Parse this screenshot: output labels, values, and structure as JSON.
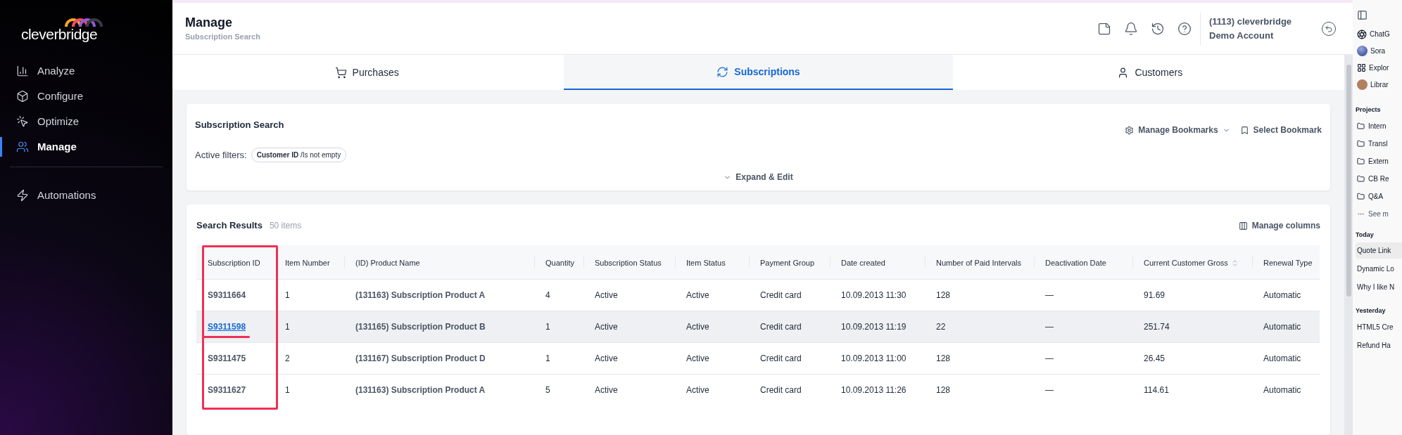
{
  "sidebar": {
    "logo": "cleverbridge",
    "items": [
      {
        "label": "Analyze",
        "selected": false
      },
      {
        "label": "Configure",
        "selected": false
      },
      {
        "label": "Optimize",
        "selected": false
      },
      {
        "label": "Manage",
        "selected": true
      }
    ],
    "bottom_items": [
      {
        "label": "Automations",
        "selected": false
      }
    ]
  },
  "header": {
    "title": "Manage",
    "subtitle": "Subscription Search",
    "account": "(1113) cleverbridge Demo Account"
  },
  "tabs": [
    {
      "label": "Purchases",
      "selected": false
    },
    {
      "label": "Subscriptions",
      "selected": true
    },
    {
      "label": "Customers",
      "selected": false
    }
  ],
  "search_card": {
    "title": "Subscription Search",
    "manage_bookmarks": "Manage Bookmarks",
    "select_bookmark": "Select Bookmark",
    "filters_label": "Active filters:",
    "filters": [
      "**Customer ID** /Is not empty"
    ],
    "expand": "Expand & Edit"
  },
  "results": {
    "title": "Search Results",
    "count": "50 items",
    "manage_columns": "Manage columns",
    "columns": [
      {
        "label": "Subscription ID",
        "sortable": false,
        "highlighted": true
      },
      {
        "label": "Item Number",
        "sortable": false,
        "highlighted": false
      },
      {
        "label": "(ID) Product Name",
        "sortable": false,
        "highlighted": false
      },
      {
        "label": "Quantity",
        "sortable": false,
        "highlighted": false
      },
      {
        "label": "Subscription Status",
        "sortable": false,
        "highlighted": false
      },
      {
        "label": "Item Status",
        "sortable": false,
        "highlighted": false
      },
      {
        "label": "Payment Group",
        "sortable": false,
        "highlighted": false
      },
      {
        "label": "Date created",
        "sortable": false,
        "highlighted": false
      },
      {
        "label": "Number of Paid Intervals",
        "sortable": false,
        "highlighted": false
      },
      {
        "label": "Deactivation Date",
        "sortable": false,
        "highlighted": false
      },
      {
        "label": "Current Customer Gross",
        "sortable": true,
        "highlighted": false
      },
      {
        "label": "Renewal Type",
        "sortable": false,
        "highlighted": false
      }
    ],
    "rows": [
      {
        "hovered": false,
        "id_link": false,
        "underlined": false,
        "cells": [
          "S9311664",
          "1",
          "(131163) Subscription Product A",
          "4",
          "Active",
          "Active",
          "Credit card",
          "10.09.2013 11:30",
          "128",
          "—",
          "91.69",
          "Automatic"
        ]
      },
      {
        "hovered": true,
        "id_link": true,
        "underlined": true,
        "cells": [
          "S9311598",
          "1",
          "(131165) Subscription Product B",
          "1",
          "Active",
          "Active",
          "Credit card",
          "10.09.2013 11:19",
          "22",
          "—",
          "251.74",
          "Automatic"
        ]
      },
      {
        "hovered": false,
        "id_link": false,
        "underlined": false,
        "cells": [
          "S9311475",
          "2",
          "(131167) Subscription Product D",
          "1",
          "Active",
          "Active",
          "Credit card",
          "10.09.2013 11:00",
          "128",
          "—",
          "26.45",
          "Automatic"
        ]
      },
      {
        "hovered": false,
        "id_link": false,
        "underlined": false,
        "cells": [
          "S9311627",
          "1",
          "(131163) Subscription Product A",
          "5",
          "Active",
          "Active",
          "Credit card",
          "10.09.2013 11:26",
          "128",
          "—",
          "114.61",
          "Automatic"
        ]
      }
    ]
  },
  "side_panel": {
    "top_items": [
      "ChatG",
      "Sora",
      "Explor",
      "Librar"
    ],
    "projects_title": "Projects",
    "projects": [
      "Intern",
      "Transl",
      "Extern",
      "CB Re",
      "Q&A"
    ],
    "see_more": "See m",
    "groups": [
      {
        "title": "Today",
        "chats": [
          {
            "label": "Quote Link",
            "selected": true
          },
          {
            "label": "Dynamic Lo",
            "selected": false
          },
          {
            "label": "Why I like N",
            "selected": false
          }
        ]
      },
      {
        "title": "Yesterday",
        "chats": [
          {
            "label": "HTML5 Cre",
            "selected": false
          },
          {
            "label": "Refund Ha",
            "selected": false
          }
        ]
      }
    ]
  }
}
